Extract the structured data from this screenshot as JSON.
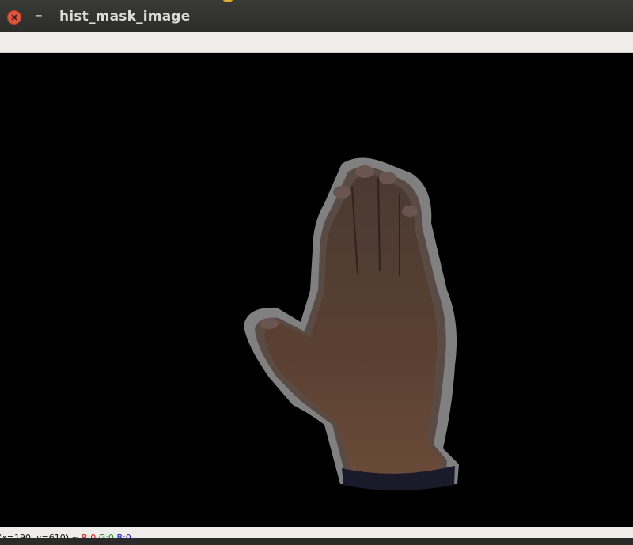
{
  "window": {
    "title": "hist_mask_image",
    "close_icon": "close-icon",
    "minimize_label": "–"
  },
  "status": {
    "coords": "(x=190, y=610) ~ ",
    "r": "R:0",
    "g": "G:0",
    "b": "B:0"
  },
  "colors": {
    "titlebar": "#2f2f2c",
    "close": "#e0563d",
    "toolbar": "#efede9",
    "canvas": "#000000"
  }
}
